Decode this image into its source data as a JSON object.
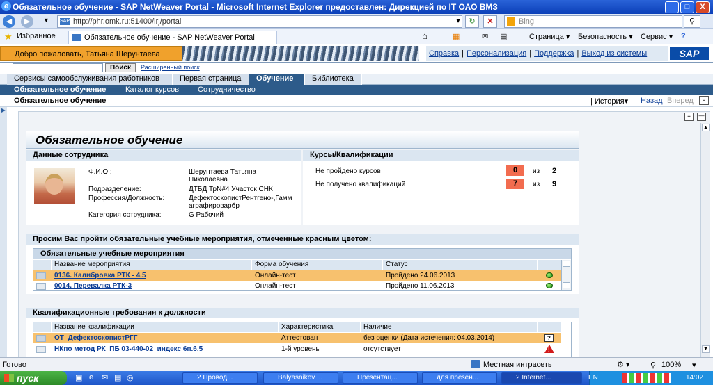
{
  "window": {
    "title": "Обязательное обучение - SAP NetWeaver Portal - Microsoft Internet Explorer предоставлен: Дирекцией по IT ОАО ВМЗ",
    "min": "_",
    "max": "□",
    "close": "X"
  },
  "browser": {
    "url": "http://phr.omk.ru:51400/irj/portal",
    "search_placeholder": "Bing",
    "favorites_label": "Избранное",
    "tab_title": "Обязательное обучение - SAP NetWeaver Portal",
    "cmd_page": "Страница ▾",
    "cmd_security": "Безопасность ▾",
    "cmd_service": "Сервис ▾",
    "favicon_text": "SAP"
  },
  "sap": {
    "welcome": "Добро пожаловать, Татьяна Шерунтаева",
    "links": [
      "Справка",
      "Персонализация",
      "Поддержка",
      "Выход из системы"
    ],
    "logo": "SAP",
    "search_button": "Поиск",
    "advanced_search": "Расширенный поиск",
    "top_nav": [
      "Сервисы самообслуживания работников",
      "Первая страница",
      "Обучение",
      "Библиотека"
    ],
    "sub_nav": [
      "Обязательное обучение",
      "|",
      "Каталог курсов",
      "|",
      "Сотрудничество"
    ],
    "page_title": "Обязательное обучение",
    "history": "История",
    "back": "Назад",
    "forward": "Вперед"
  },
  "main": {
    "heading": "Обязательное обучение",
    "employee": {
      "section": "Данные сотрудника",
      "fio_label": "Ф.И.О.:",
      "fio": "Шерунтаева Татьяна Николаевна",
      "dept_label": "Подразделение:",
      "dept": "ДТБД ТрN#4 Участок СНК",
      "prof_label": "Профессия/Должность:",
      "prof": "ДефектоскопистРентгено-,Гаммаграфироварбр",
      "cat_label": "Категория сотрудника:",
      "cat": "G Рабочий"
    },
    "courses": {
      "section": "Курсы/Квалификации",
      "not_passed_label": "Не пройдено курсов",
      "not_passed": "0",
      "not_passed_total": "2",
      "not_got_label": "Не получено квалификаций",
      "not_got": "7",
      "not_got_total": "9",
      "of": "из"
    },
    "notice": "Просим Вас пройти обязательные учебные мероприятия, отмеченные красным цветом:",
    "events": {
      "title": "Обязательные учебные мероприятия",
      "cols": [
        "Название мероприятия",
        "Форма обучения",
        "Статус"
      ],
      "rows": [
        {
          "name": "0136. Калибровка РТК - 4.5",
          "form": "Онлайн-тест",
          "status": "Пройдено 24.06.2013"
        },
        {
          "name": "0014. Перевалка РТК-3",
          "form": "Онлайн-тест",
          "status": "Пройдено 11.06.2013"
        }
      ]
    },
    "quals": {
      "title": "Квалификационные требования к должности",
      "cols": [
        "Название квалификации",
        "Характеристика",
        "Наличие"
      ],
      "rows": [
        {
          "name": "ОТ_ДефектоскопистРГГ",
          "char": "Аттестован",
          "have": "без оценки (Дата истечения: 04.03.2014)",
          "icon": "?"
        },
        {
          "name": "НКпо метод РК_ПБ 03-440-02_индекс 6п.6.5",
          "char": "1-й уровень",
          "have": "отсутствует",
          "icon": "!"
        }
      ]
    }
  },
  "status": {
    "left": "Готово",
    "zone": "Местная интрасеть",
    "zoom": "100%"
  },
  "taskbar": {
    "start": "пуск",
    "tasks": [
      "2 Провод...",
      "Balyasnikov ...",
      "Презентац...",
      "для презен...",
      "2 Internet..."
    ],
    "lang": "EN",
    "clock": "14:02"
  }
}
